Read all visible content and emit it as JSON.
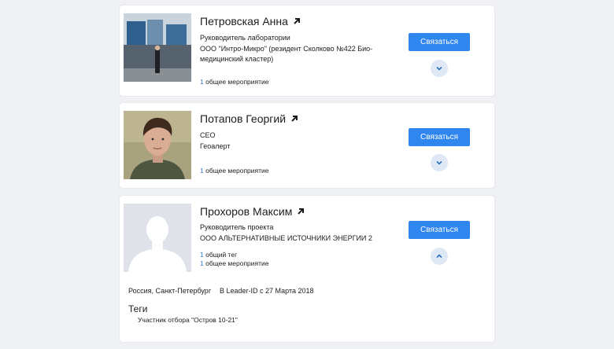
{
  "people": [
    {
      "name": "Петровская Анна",
      "role": "Руководитель лаборатории",
      "org": "ООО \"Интро-Микро\" (резидент Сколково №422 Био-медицинский кластер)",
      "events_count": "1",
      "events_label": "общее мероприятие",
      "button_label": "Связаться",
      "toggle_icon": "chevron-down-icon"
    },
    {
      "name": "Потапов Георгий",
      "role": "CEO",
      "org": "Геоалерт",
      "events_count": "1",
      "events_label": "общее мероприятие",
      "button_label": "Связаться",
      "toggle_icon": "chevron-down-icon"
    },
    {
      "name": "Прохоров Максим",
      "role": "Руководитель проекта",
      "org": "ООО АЛЬТЕРНАТИВНЫЕ ИСТОЧНИКИ ЭНЕРГИИ 2",
      "tags_count": "1",
      "tags_label": "общий тег",
      "events_count": "1",
      "events_label": "общее мероприятие",
      "button_label": "Связаться",
      "toggle_icon": "chevron-up-icon",
      "location": "Россия, Санкт-Петербург",
      "since": "В Leader-ID с 27 Марта 2018",
      "tags_title": "Теги",
      "tags": [
        "Участник отбора \"Остров 10-21\""
      ]
    }
  ],
  "colors": {
    "accent": "#2f86ee",
    "link": "#2e7bd6",
    "toggle_bg": "#dfe8f5"
  }
}
